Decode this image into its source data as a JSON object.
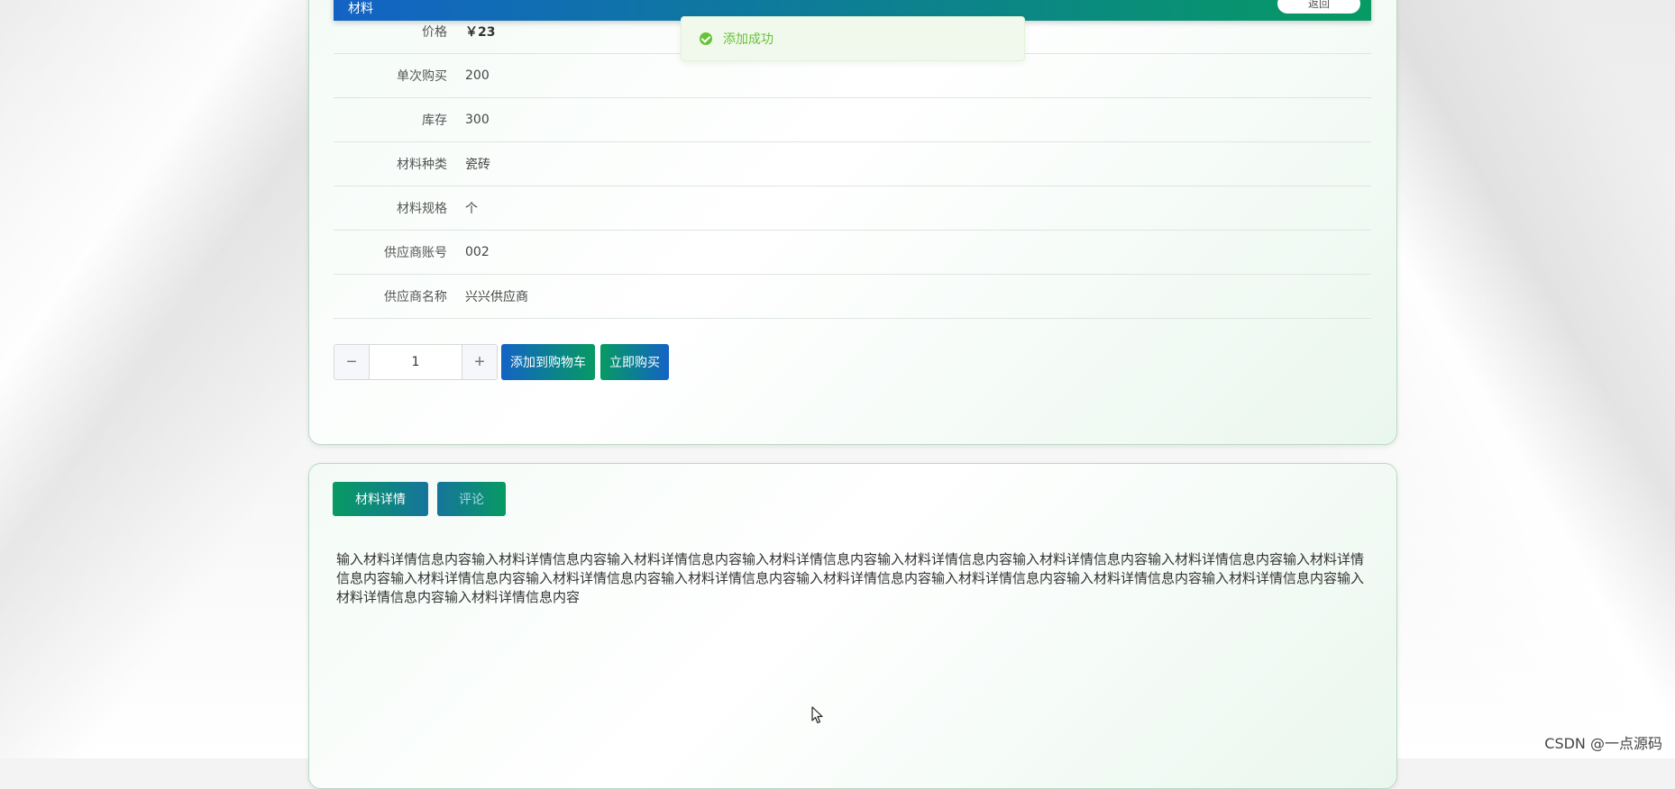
{
  "header": {
    "title": "材料",
    "back_button": "返回"
  },
  "toast": {
    "message": "添加成功",
    "color": "#67c23a"
  },
  "info_rows": [
    {
      "label": "价格",
      "value": "￥23"
    },
    {
      "label": "单次购买",
      "value": "200"
    },
    {
      "label": "库存",
      "value": "300"
    },
    {
      "label": "材料种类",
      "value": "瓷砖"
    },
    {
      "label": "材料规格",
      "value": "个"
    },
    {
      "label": "供应商账号",
      "value": "002"
    },
    {
      "label": "供应商名称",
      "value": "兴兴供应商"
    }
  ],
  "quantity": {
    "minus": "−",
    "value": "1",
    "plus": "+"
  },
  "actions": {
    "add_to_cart": "添加到购物车",
    "buy_now": "立即购买"
  },
  "tabs": {
    "detail": "材料详情",
    "comment": "评论"
  },
  "detail": {
    "text": "输入材料详情信息内容输入材料详情信息内容输入材料详情信息内容输入材料详情信息内容输入材料详情信息内容输入材料详情信息内容输入材料详情信息内容输入材料详情信息内容输入材料详情信息内容输入材料详情信息内容输入材料详情信息内容输入材料详情信息内容输入材料详情信息内容输入材料详情信息内容输入材料详情信息内容输入材料详情信息内容输入材料详情信息内容"
  },
  "watermark": "CSDN @一点源码",
  "colors": {
    "gradient_start": "#1363c5",
    "gradient_end": "#079a63"
  }
}
